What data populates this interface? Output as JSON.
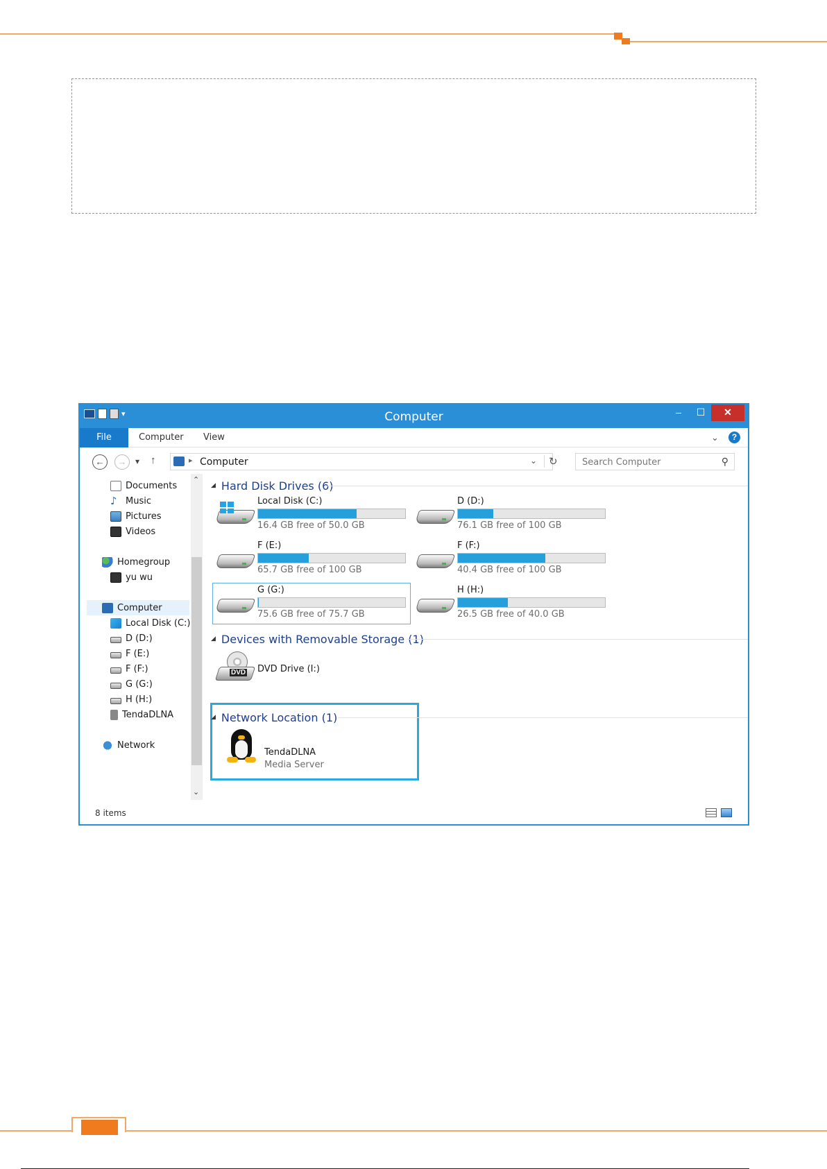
{
  "window": {
    "title": "Computer",
    "buttons": {
      "minimize": "–",
      "maximize": "☐",
      "close": "✕"
    }
  },
  "ribbon": {
    "tabs": [
      "File",
      "Computer",
      "View"
    ],
    "expand_glyph": "⌄",
    "help_glyph": "?"
  },
  "navigation": {
    "back_glyph": "←",
    "forward_glyph": "→",
    "recent_glyph": "▾",
    "up_glyph": "↑",
    "address_separator": "▸",
    "address_path": "Computer",
    "address_dropdown_glyph": "⌄",
    "refresh_glyph": "↻",
    "search_placeholder": "Search Computer",
    "search_glyph": "⚲"
  },
  "sidebar": {
    "items": [
      {
        "label": "Documents",
        "icon": "documents-icon"
      },
      {
        "label": "Music",
        "icon": "music-icon"
      },
      {
        "label": "Pictures",
        "icon": "pictures-icon"
      },
      {
        "label": "Videos",
        "icon": "videos-icon"
      },
      {
        "label": "Homegroup",
        "icon": "homegroup-icon"
      },
      {
        "label": "yu wu",
        "icon": "user-icon"
      },
      {
        "label": "Computer",
        "icon": "computer-icon",
        "selected": true
      },
      {
        "label": "Local Disk (C:)",
        "icon": "windows-drive-icon"
      },
      {
        "label": "D (D:)",
        "icon": "drive-icon"
      },
      {
        "label": "F (E:)",
        "icon": "drive-icon"
      },
      {
        "label": "F (F:)",
        "icon": "drive-icon"
      },
      {
        "label": "G (G:)",
        "icon": "drive-icon"
      },
      {
        "label": "H (H:)",
        "icon": "drive-icon"
      },
      {
        "label": "TendaDLNA",
        "icon": "media-server-icon"
      },
      {
        "label": "Network",
        "icon": "network-icon"
      }
    ],
    "scroll_up_glyph": "⌃",
    "scroll_down_glyph": "⌄"
  },
  "groups": {
    "hard_disk_drives": "Hard Disk Drives (6)",
    "removable_storage": "Devices with Removable Storage (1)",
    "network_location": "Network Location (1)",
    "collapse_glyph": "◢"
  },
  "drives": [
    {
      "name": "Local Disk (C:)",
      "free": "16.4 GB free of 50.0 GB",
      "used_fraction": 0.672
    },
    {
      "name": "D (D:)",
      "free": "76.1 GB free of 100 GB",
      "used_fraction": 0.239
    },
    {
      "name": "F (E:)",
      "free": "65.7 GB free of 100 GB",
      "used_fraction": 0.343
    },
    {
      "name": "F (F:)",
      "free": "40.4 GB free of 100 GB",
      "used_fraction": 0.596
    },
    {
      "name": "G (G:)",
      "free": "75.6 GB free of 75.7 GB",
      "used_fraction": 0.001
    },
    {
      "name": "H (H:)",
      "free": "26.5 GB free of 40.0 GB",
      "used_fraction": 0.338
    }
  ],
  "removable": {
    "name": "DVD Drive (I:)",
    "badge": "DVD"
  },
  "network_location": {
    "name": "TendaDLNA",
    "subtitle": "Media Server"
  },
  "status": {
    "item_count": "8 items"
  },
  "colors": {
    "accent": "#2b8fd8",
    "bar_fill": "#26a0da",
    "highlight_box": "#27a9e1",
    "page_accent": "#f07b1e"
  }
}
